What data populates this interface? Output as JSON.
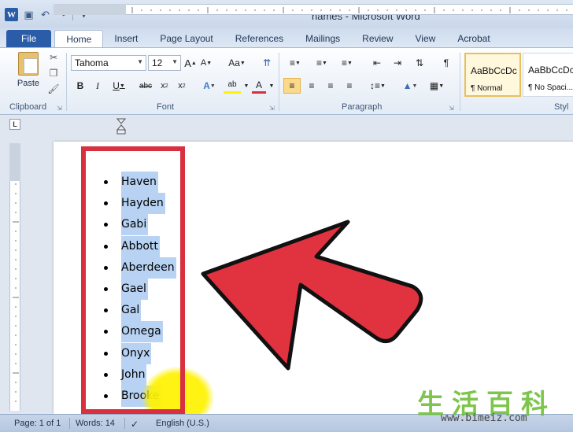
{
  "window": {
    "title": "names  -  Microsoft Word",
    "logo_letter": "W"
  },
  "tabs": [
    {
      "label": "File"
    },
    {
      "label": "Home"
    },
    {
      "label": "Insert"
    },
    {
      "label": "Page Layout"
    },
    {
      "label": "References"
    },
    {
      "label": "Mailings"
    },
    {
      "label": "Review"
    },
    {
      "label": "View"
    },
    {
      "label": "Acrobat"
    }
  ],
  "ribbon": {
    "clipboard": {
      "paste_label": "Paste",
      "group_label": "Clipboard"
    },
    "font": {
      "font_name": "Tahoma",
      "font_size": "12",
      "group_label": "Font",
      "change_case": "Aa"
    },
    "paragraph": {
      "group_label": "Paragraph"
    },
    "styles": {
      "items": [
        {
          "preview": "AaBbCcDc",
          "name": "¶ Normal"
        },
        {
          "preview": "AaBbCcDc",
          "name": "¶ No Spaci..."
        }
      ],
      "group_label": "Styl"
    }
  },
  "document": {
    "list_items": [
      "Haven",
      "Hayden",
      "Gabi",
      "Abbott",
      "Aberdeen",
      "Gael",
      "Gal",
      "Omega",
      "Onyx",
      "John",
      "Brooke"
    ]
  },
  "statusbar": {
    "page": "Page: 1 of 1",
    "words": "Words: 14",
    "language": "English (U.S.)"
  },
  "watermark": {
    "chars": "生活百科",
    "url": "www.bimeiz.com"
  },
  "colors": {
    "file_tab": "#2a5ca8",
    "selection": "#b7d2f3",
    "annotation_red": "#d9303f",
    "cursor_highlight": "#fff200"
  }
}
